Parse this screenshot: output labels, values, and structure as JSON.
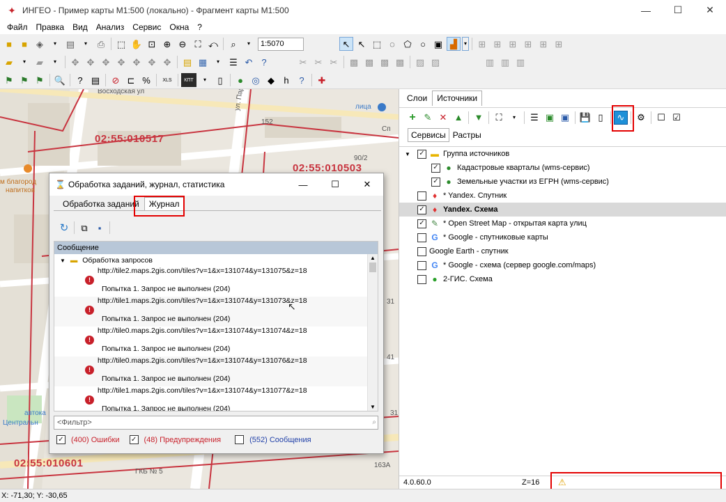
{
  "window": {
    "title": "ИНГЕО - Пример карты M1:500 (локально) - Фрагмент карты M1:500",
    "app_icon": "ingeo-logo-icon",
    "minimize_glyph": "—",
    "maximize_glyph": "☐",
    "close_glyph": "✕"
  },
  "menu": [
    "Файл",
    "Правка",
    "Вид",
    "Анализ",
    "Сервис",
    "Окна",
    "?"
  ],
  "toolbar": {
    "scale_value": "1:5070",
    "xls_label": "XLS",
    "kpt_label": "КПТ"
  },
  "map": {
    "parcels": [
      "02:55:010517",
      "02:55:010503",
      "02:55:010601"
    ],
    "streets": [
      "Восходская ул",
      "ул. Пархоме...",
      "лица",
      "Сп",
      "ГКБ № 5",
      "автока",
      "Центральн",
      "м благород",
      "напитков"
    ],
    "numbers": [
      "152",
      "90/2",
      "31",
      "163А",
      "41",
      "31"
    ]
  },
  "right_panel": {
    "tabs": [
      "Слои",
      "Источники"
    ],
    "active_tab": 1,
    "sub_tabs": [
      "Сервисы",
      "Растры"
    ],
    "active_sub_tab": 0,
    "tree": [
      {
        "label": "Группа источников",
        "checked": true,
        "icon": "folder-icon",
        "indent": 0,
        "selected": false
      },
      {
        "label": "Кадастровые кварталы (wms-сервис)",
        "checked": true,
        "icon": "globe-icon",
        "indent": 1,
        "selected": false
      },
      {
        "label": "Земельные участки из ЕГРН (wms-сервис)",
        "checked": true,
        "icon": "globe-icon",
        "indent": 1,
        "selected": false
      },
      {
        "label": "* Yandex. Спутник",
        "checked": false,
        "icon": "yandex-pin-icon",
        "indent": 0,
        "selected": false
      },
      {
        "label": "Yandex. Схема",
        "checked": true,
        "icon": "yandex-pin-icon",
        "indent": 0,
        "selected": true
      },
      {
        "label": "* Open Street Map - открытая карта улиц",
        "checked": true,
        "icon": "osm-icon",
        "indent": 0,
        "selected": false
      },
      {
        "label": "* Google - спутниковые карты",
        "checked": false,
        "icon": "google-icon",
        "indent": 0,
        "selected": false
      },
      {
        "label": "Google Earth - спутник",
        "checked": false,
        "icon": "none",
        "indent": 0,
        "selected": false
      },
      {
        "label": "* Google - схема (сервер google.com/maps)",
        "checked": false,
        "icon": "google-icon",
        "indent": 0,
        "selected": false
      },
      {
        "label": "2-ГИС. Схема",
        "checked": false,
        "icon": "2gis-icon",
        "indent": 0,
        "selected": false
      }
    ],
    "status": {
      "version": "4.0.60.0",
      "zoom": "Z=16",
      "warning_icon": "warning-icon"
    }
  },
  "dialog": {
    "title": "Обработка заданий, журнал, статистика",
    "tabs": [
      "Обработка заданий",
      "Журнал"
    ],
    "active_tab": 1,
    "list_header": "Сообщение",
    "group": "Обработка запросов",
    "entries": [
      {
        "url": "http://tile2.maps.2gis.com/tiles?v=1&x=131074&y=131075&z=18",
        "msg": "Попытка 1. Запрос не выполнен (204)"
      },
      {
        "url": "http://tile1.maps.2gis.com/tiles?v=1&x=131074&y=131073&z=18",
        "msg": "Попытка 1. Запрос не выполнен (204)"
      },
      {
        "url": "http://tile0.maps.2gis.com/tiles?v=1&x=131074&y=131074&z=18",
        "msg": "Попытка 1. Запрос не выполнен (204)"
      },
      {
        "url": "http://tile0.maps.2gis.com/tiles?v=1&x=131074&y=131076&z=18",
        "msg": "Попытка 1. Запрос не выполнен (204)"
      },
      {
        "url": "http://tile1.maps.2gis.com/tiles?v=1&x=131074&y=131077&z=18",
        "msg": "Попытка 1. Запрос не выполнен (204)"
      }
    ],
    "filter_placeholder": "<Фильтр>",
    "filters": [
      {
        "label": "(400) Ошибки",
        "checked": true,
        "color": "#c8202a"
      },
      {
        "label": "(48) Предупреждения",
        "checked": true,
        "color": "#c8202a"
      },
      {
        "label": "(552) Сообщения",
        "checked": false,
        "color": "#1f3fa8"
      }
    ]
  },
  "statusbar": {
    "coords": "X: -71,30; Y: -30,65"
  }
}
